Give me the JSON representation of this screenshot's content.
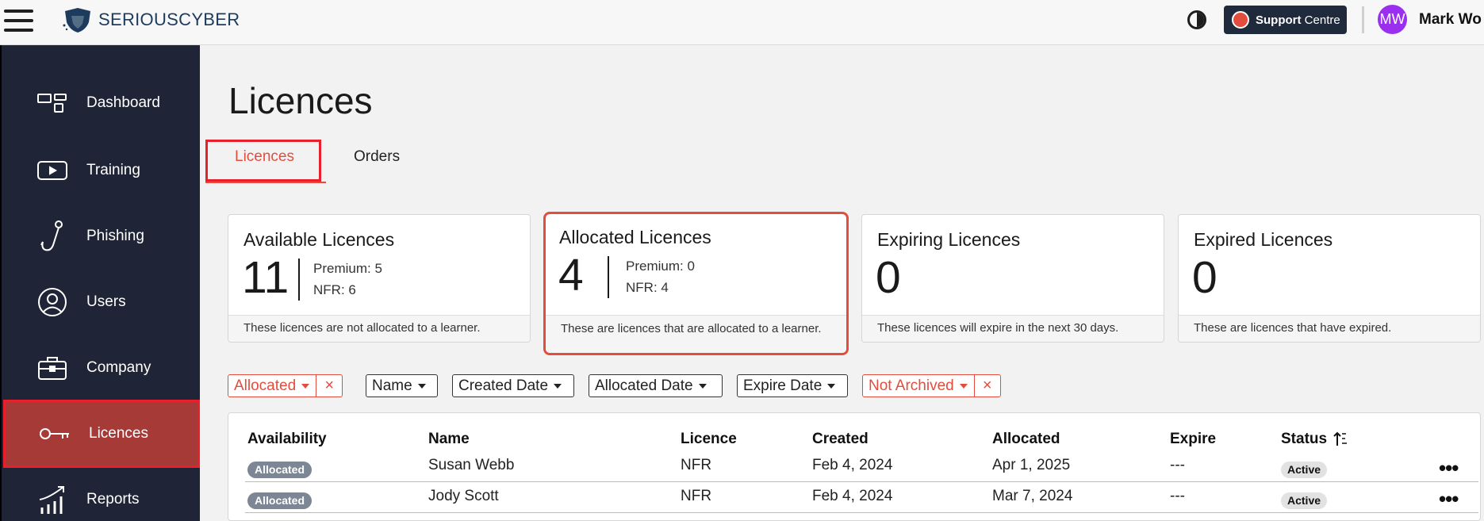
{
  "topbar": {
    "logo_part1": "SERIOUS",
    "logo_part2": "CYBER",
    "support_bold": "Support",
    "support_rest": "Centre",
    "avatar_initials": "MW",
    "user_name": "Mark Wo"
  },
  "sidebar": {
    "items": [
      {
        "label": "Dashboard",
        "icon": "dashboard-icon"
      },
      {
        "label": "Training",
        "icon": "play-icon"
      },
      {
        "label": "Phishing",
        "icon": "hook-icon"
      },
      {
        "label": "Users",
        "icon": "user-icon"
      },
      {
        "label": "Company",
        "icon": "briefcase-icon"
      },
      {
        "label": "Licences",
        "icon": "key-icon",
        "active": true
      },
      {
        "label": "Reports",
        "icon": "chart-icon"
      }
    ]
  },
  "page": {
    "title": "Licences",
    "tabs": [
      "Licences",
      "Orders"
    ],
    "active_tab": "Licences"
  },
  "cards": [
    {
      "title": "Available Licences",
      "value": "11",
      "premium": "Premium: 5",
      "nfr": "NFR: 6",
      "footer": "These licences are not allocated to a learner."
    },
    {
      "title": "Allocated Licences",
      "value": "4",
      "premium": "Premium: 0",
      "nfr": "NFR: 4",
      "footer": "These are licences that are allocated to a learner."
    },
    {
      "title": "Expiring Licences",
      "value": "0",
      "footer": "These licences will expire in the next 30 days."
    },
    {
      "title": "Expired Licences",
      "value": "0",
      "footer": "These are licences that have expired."
    }
  ],
  "filters": {
    "allocated": "Allocated",
    "name": "Name",
    "created_date": "Created Date",
    "allocated_date": "Allocated Date",
    "expire_date": "Expire Date",
    "archived": "Not Archived",
    "clear_symbol": "×"
  },
  "table": {
    "headers": [
      "Availability",
      "Name",
      "Licence",
      "Created",
      "Allocated",
      "Expire",
      "Status"
    ],
    "rows": [
      {
        "availability": "Allocated",
        "name": "Susan Webb",
        "licence": "NFR",
        "created": "Feb 4, 2024",
        "allocated": "Apr 1, 2025",
        "expire": "---",
        "status": "Active"
      },
      {
        "availability": "Allocated",
        "name": "Jody Scott",
        "licence": "NFR",
        "created": "Feb 4, 2024",
        "allocated": "Mar 7, 2024",
        "expire": "---",
        "status": "Active"
      }
    ],
    "more_symbol": "•••"
  },
  "colors": {
    "accent": "#e34d3d",
    "sidebar_bg": "#1f2536",
    "sidebar_active": "#a63a36",
    "support_bg": "#1f2a3c",
    "avatar_bg": "#9b2ff0"
  }
}
